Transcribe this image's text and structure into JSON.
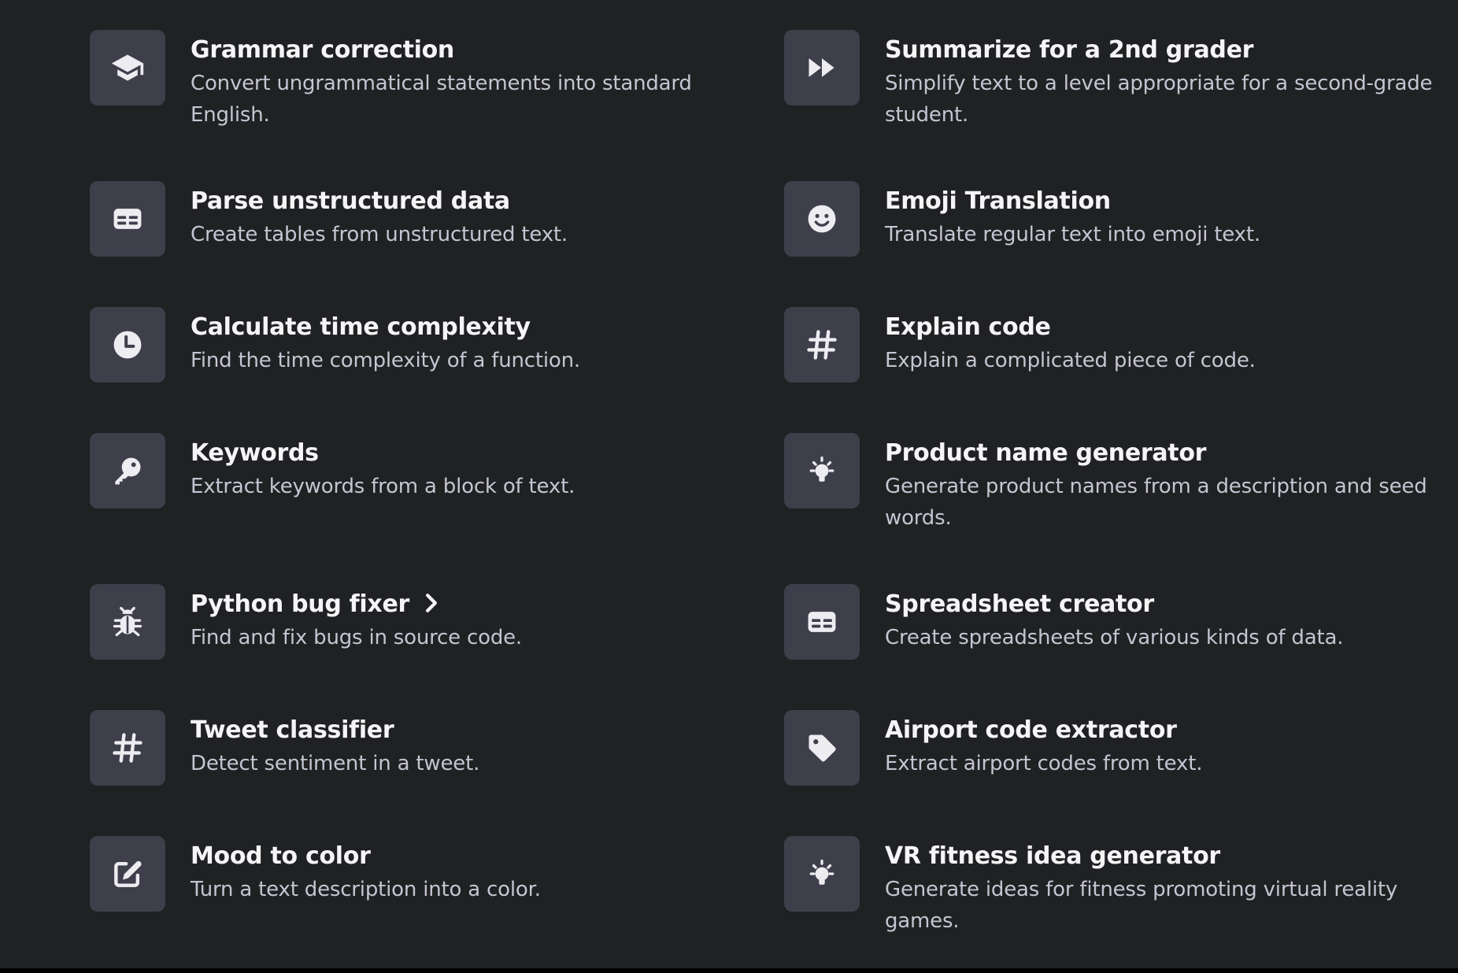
{
  "examples": [
    {
      "title": "Grammar correction",
      "description": "Convert ungrammatical statements into standard English.",
      "icon": "graduation-cap-icon"
    },
    {
      "title": "Summarize for a 2nd grader",
      "description": "Simplify text to a level appropriate for a second-grade student.",
      "icon": "fast-forward-icon"
    },
    {
      "title": "Parse unstructured data",
      "description": "Create tables from unstructured text.",
      "icon": "table-icon"
    },
    {
      "title": "Emoji Translation",
      "description": "Translate regular text into emoji text.",
      "icon": "smiley-icon"
    },
    {
      "title": "Calculate time complexity",
      "description": "Find the time complexity of a function.",
      "icon": "clock-icon"
    },
    {
      "title": "Explain code",
      "description": "Explain a complicated piece of code.",
      "icon": "hashtag-icon"
    },
    {
      "title": "Keywords",
      "description": "Extract keywords from a block of text.",
      "icon": "key-icon"
    },
    {
      "title": "Product name generator",
      "description": "Generate product names from a description and seed words.",
      "icon": "lightbulb-icon"
    },
    {
      "title": "Python bug fixer",
      "description": "Find and fix bugs in source code.",
      "icon": "bug-icon"
    },
    {
      "title": "Spreadsheet creator",
      "description": "Create spreadsheets of various kinds of data.",
      "icon": "table-icon"
    },
    {
      "title": "Tweet classifier",
      "description": "Detect sentiment in a tweet.",
      "icon": "hashtag-icon"
    },
    {
      "title": "Airport code extractor",
      "description": "Extract airport codes from text.",
      "icon": "tag-icon"
    },
    {
      "title": "Mood to color",
      "description": "Turn a text description into a color.",
      "icon": "edit-icon"
    },
    {
      "title": "VR fitness idea generator",
      "description": "Generate ideas for fitness promoting virtual reality games.",
      "icon": "lightbulb-icon"
    }
  ],
  "colors": {
    "background": "#202123",
    "tile": "#3e3f4b",
    "title": "#f5f5f7",
    "description": "#c5c5d2",
    "icon": "#ececf1"
  }
}
